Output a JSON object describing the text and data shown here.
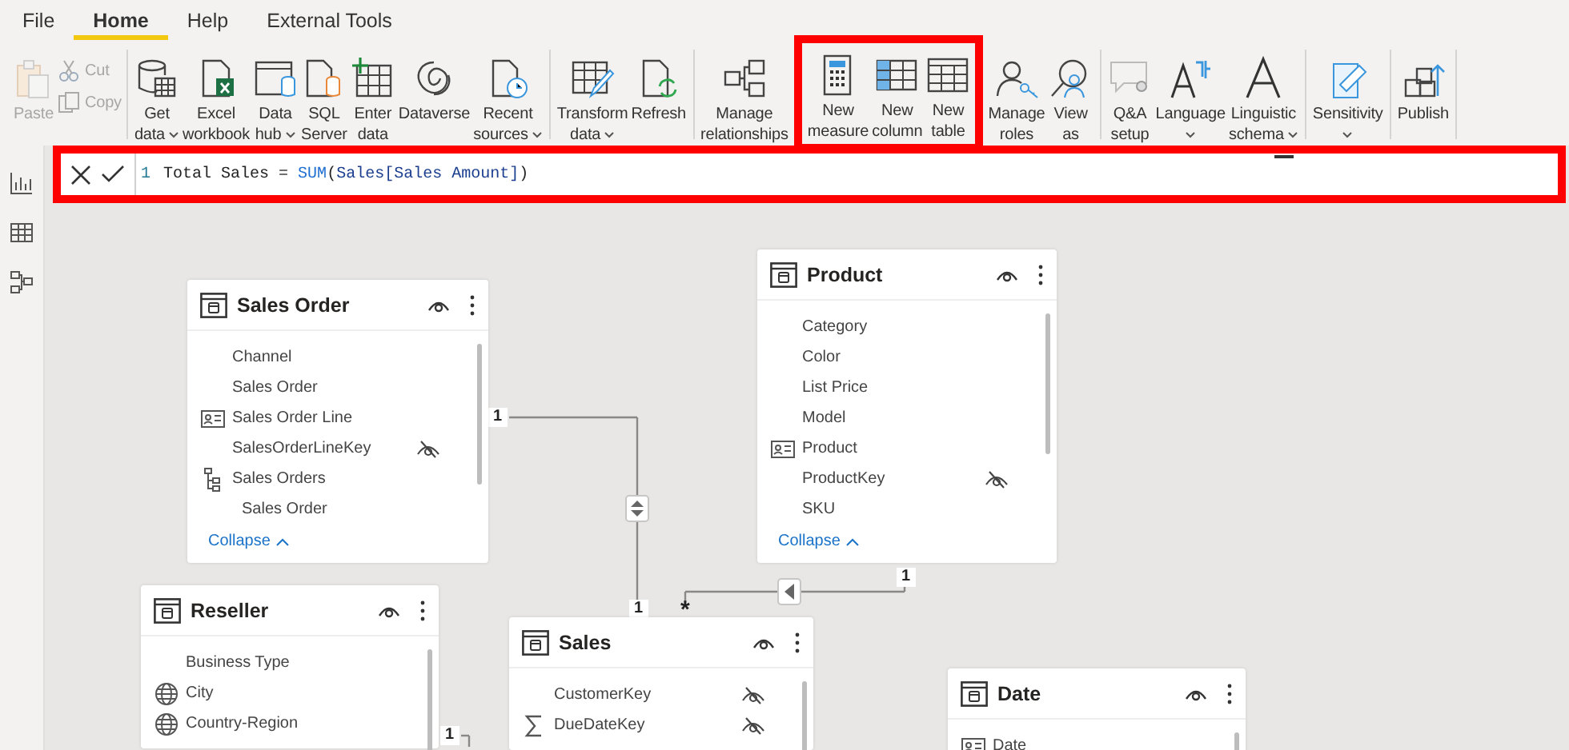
{
  "menu": {
    "tabs": [
      {
        "label": "File",
        "selected": false
      },
      {
        "label": "Home",
        "selected": true
      },
      {
        "label": "Help",
        "selected": false
      },
      {
        "label": "External Tools",
        "selected": false
      }
    ]
  },
  "ribbon": {
    "groups": [
      {
        "highlighted": false,
        "buttons": [
          {
            "kind": "large",
            "lines": [
              "Paste"
            ],
            "dropdown": false,
            "disabled": true
          },
          {
            "kind": "small",
            "lines": [
              "Cut"
            ],
            "disabled": true
          },
          {
            "kind": "small",
            "lines": [
              "Copy"
            ],
            "disabled": true
          }
        ]
      },
      {
        "highlighted": false,
        "buttons": [
          {
            "kind": "large",
            "lines": [
              "Get",
              "data"
            ],
            "dropdown": true,
            "disabled": false
          },
          {
            "kind": "large",
            "lines": [
              "Excel",
              "workbook"
            ],
            "dropdown": false,
            "disabled": false
          },
          {
            "kind": "large",
            "lines": [
              "Data",
              "hub"
            ],
            "dropdown": true,
            "disabled": false
          },
          {
            "kind": "large",
            "lines": [
              "SQL",
              "Server"
            ],
            "dropdown": false,
            "disabled": false
          },
          {
            "kind": "large",
            "lines": [
              "Enter",
              "data"
            ],
            "dropdown": false,
            "disabled": false
          },
          {
            "kind": "large",
            "lines": [
              "Dataverse"
            ],
            "dropdown": false,
            "disabled": false
          },
          {
            "kind": "large",
            "lines": [
              "Recent",
              "sources"
            ],
            "dropdown": true,
            "disabled": false
          }
        ]
      },
      {
        "highlighted": false,
        "buttons": [
          {
            "kind": "large",
            "lines": [
              "Transform",
              "data"
            ],
            "dropdown": true,
            "disabled": false
          },
          {
            "kind": "large",
            "lines": [
              "Refresh"
            ],
            "dropdown": false,
            "disabled": false
          }
        ]
      },
      {
        "highlighted": false,
        "buttons": [
          {
            "kind": "large",
            "lines": [
              "Manage",
              "relationships"
            ],
            "dropdown": false,
            "disabled": false
          }
        ]
      },
      {
        "highlighted": true,
        "buttons": [
          {
            "kind": "large",
            "lines": [
              "New",
              "measure"
            ],
            "dropdown": false,
            "disabled": false
          },
          {
            "kind": "large",
            "lines": [
              "New",
              "column"
            ],
            "dropdown": false,
            "disabled": false
          },
          {
            "kind": "large",
            "lines": [
              "New",
              "table"
            ],
            "dropdown": false,
            "disabled": false
          }
        ]
      },
      {
        "highlighted": false,
        "buttons": [
          {
            "kind": "large",
            "lines": [
              "Manage",
              "roles"
            ],
            "dropdown": false,
            "disabled": false
          },
          {
            "kind": "large",
            "lines": [
              "View",
              "as"
            ],
            "dropdown": false,
            "disabled": false
          }
        ]
      },
      {
        "highlighted": false,
        "buttons": [
          {
            "kind": "large",
            "lines": [
              "Q&A",
              "setup"
            ],
            "dropdown": false,
            "disabled": false
          },
          {
            "kind": "large",
            "lines": [
              "Language"
            ],
            "dropdown": true,
            "disabled": false
          },
          {
            "kind": "large",
            "lines": [
              "Linguistic",
              "schema"
            ],
            "dropdown": true,
            "disabled": false
          }
        ]
      },
      {
        "highlighted": false,
        "buttons": [
          {
            "kind": "large",
            "lines": [
              "Sensitivity"
            ],
            "dropdown": true,
            "disabled": false
          }
        ]
      },
      {
        "highlighted": false,
        "buttons": [
          {
            "kind": "large",
            "lines": [
              "Publish"
            ],
            "dropdown": false,
            "disabled": false
          }
        ]
      }
    ]
  },
  "formula_bar": {
    "highlighted": true,
    "line_number": "1",
    "tokens": [
      {
        "text": "Total Sales ",
        "kind": "text"
      },
      {
        "text": "= ",
        "kind": "operator"
      },
      {
        "text": "SUM",
        "kind": "function"
      },
      {
        "text": "(",
        "kind": "text"
      },
      {
        "text": "Sales[Sales Amount]",
        "kind": "reference"
      },
      {
        "text": ")",
        "kind": "text"
      }
    ]
  },
  "diagram": {
    "tables": [
      {
        "name": "Sales Order",
        "fields": [
          {
            "name": "Channel",
            "kind": "plain",
            "hidden": false
          },
          {
            "name": "Sales Order",
            "kind": "plain",
            "hidden": false
          },
          {
            "name": "Sales Order Line",
            "kind": "id",
            "hidden": false
          },
          {
            "name": "SalesOrderLineKey",
            "kind": "plain",
            "hidden": true
          },
          {
            "name": "Sales Orders",
            "kind": "hierarchy",
            "hidden": false,
            "children": [
              {
                "name": "Sales Order",
                "hidden": false
              }
            ]
          }
        ],
        "collapse": "Collapse"
      },
      {
        "name": "Product",
        "fields": [
          {
            "name": "Category",
            "kind": "plain",
            "hidden": false
          },
          {
            "name": "Color",
            "kind": "plain",
            "hidden": false
          },
          {
            "name": "List Price",
            "kind": "plain",
            "hidden": false
          },
          {
            "name": "Model",
            "kind": "plain",
            "hidden": false
          },
          {
            "name": "Product",
            "kind": "id",
            "hidden": false
          },
          {
            "name": "ProductKey",
            "kind": "plain",
            "hidden": true
          },
          {
            "name": "SKU",
            "kind": "plain",
            "hidden": false
          }
        ],
        "collapse": "Collapse"
      },
      {
        "name": "Reseller",
        "fields": [
          {
            "name": "Business Type",
            "kind": "plain",
            "hidden": false
          },
          {
            "name": "City",
            "kind": "globe",
            "hidden": false
          },
          {
            "name": "Country-Region",
            "kind": "globe",
            "hidden": false
          }
        ]
      },
      {
        "name": "Sales",
        "fields": [
          {
            "name": "CustomerKey",
            "kind": "plain",
            "hidden": true
          },
          {
            "name": "DueDateKey",
            "kind": "sigma",
            "hidden": true
          }
        ]
      },
      {
        "name": "Date",
        "fields": [
          {
            "name": "Date",
            "kind": "id",
            "hidden": false
          }
        ]
      }
    ],
    "relationships": [
      {
        "from_label": "1",
        "to_label": "1"
      },
      {
        "from_label": "1",
        "to_label": "*"
      },
      {
        "from_label": "1"
      }
    ]
  }
}
